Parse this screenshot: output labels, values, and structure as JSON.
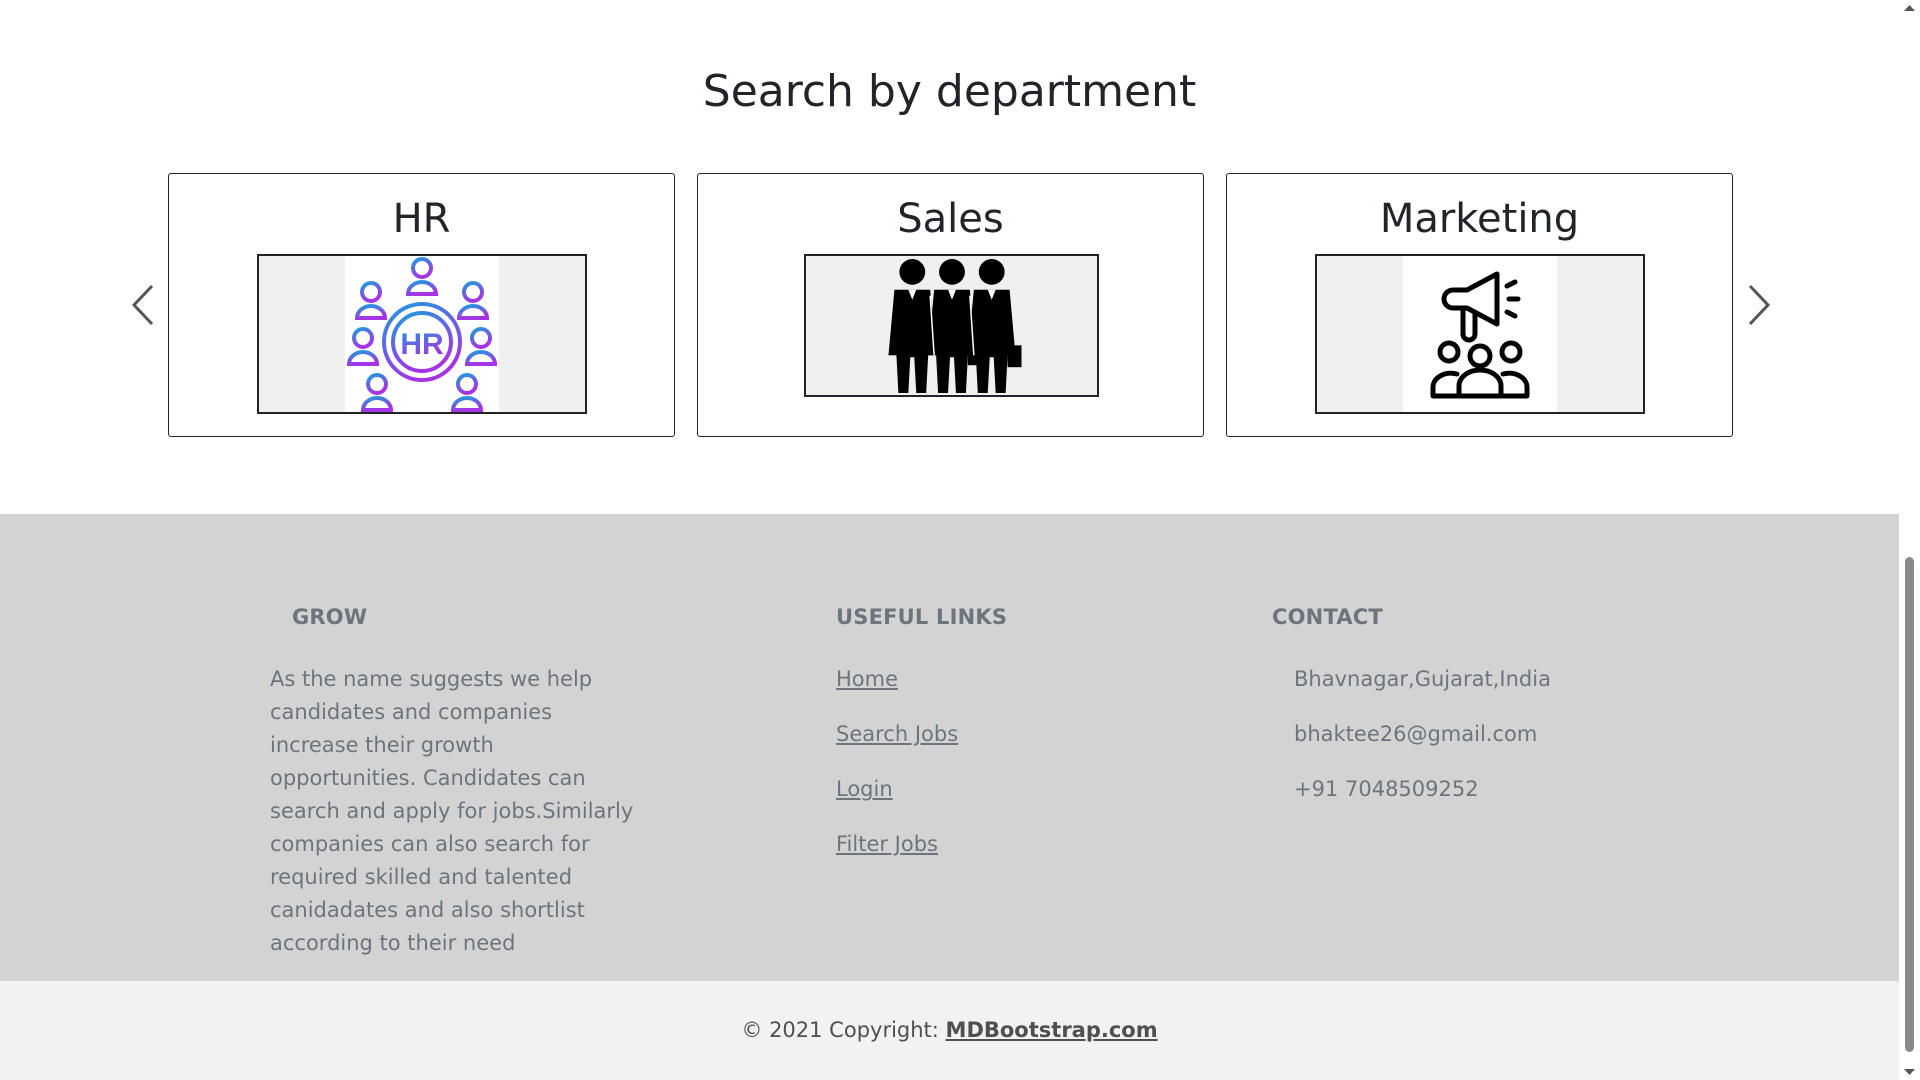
{
  "department_section": {
    "title": "Search by department",
    "cards": [
      {
        "title": "HR",
        "image_icon": "hr-network-icon",
        "image_text": "HR"
      },
      {
        "title": "Sales",
        "image_icon": "businessmen-group-icon"
      },
      {
        "title": "Marketing",
        "image_icon": "megaphone-audience-icon"
      }
    ],
    "prev_icon": "chevron-left-icon",
    "next_icon": "chevron-right-icon"
  },
  "footer": {
    "about": {
      "heading": "GROW",
      "text": "As the name suggests we help candidates and companies increase their growth opportunities. Candidates can search and apply for jobs.Similarly companies can also search for required skilled and talented canidadates and also shortlist according to their need"
    },
    "useful_links": {
      "heading": "USEFUL LINKS",
      "links": [
        "Home",
        "Search Jobs",
        "Login",
        "Filter Jobs"
      ]
    },
    "contact": {
      "heading": "CONTACT",
      "address": "Bhavnagar,Gujarat,India",
      "email": "bhaktee26@gmail.com",
      "phone": "+91 7048509252"
    }
  },
  "copyright": {
    "prefix": "© 2021 Copyright: ",
    "link_text": "MDBootstrap.com"
  },
  "colors": {
    "footer_bg": "#d3d3d4",
    "copyright_bg": "#f2f2f2",
    "muted_text": "#6c757d",
    "hr_gradient_start": "#1e9be0",
    "hr_gradient_end": "#a633e6"
  }
}
